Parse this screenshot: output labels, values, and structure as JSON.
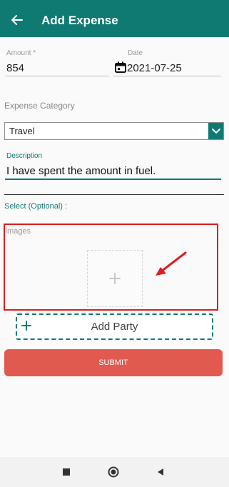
{
  "appbar": {
    "title": "Add Expense"
  },
  "form": {
    "amount": {
      "label": "Amount *",
      "value": "854"
    },
    "date": {
      "label": "Date",
      "value": "2021-07-25"
    },
    "category": {
      "label": "Expense Category",
      "selected": "Travel"
    },
    "description": {
      "label": "Description",
      "value": "I have spent the amount in fuel."
    },
    "optional_label": "Select (Optional) :",
    "images_label": "Images",
    "add_party_label": "Add Party",
    "submit_label": "SUBMIT"
  },
  "colors": {
    "primary": "#0f7a72",
    "submit": "#e05a4f",
    "highlight": "#e11b1b"
  },
  "icons": [
    "back-arrow-icon",
    "calendar-icon",
    "chevron-down-icon",
    "plus-icon",
    "nav-recents-icon",
    "nav-home-icon",
    "nav-back-icon"
  ]
}
